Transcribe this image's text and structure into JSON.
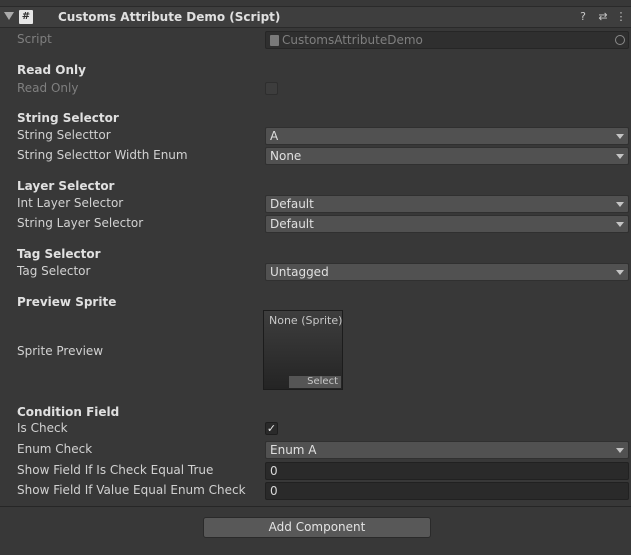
{
  "header": {
    "title": "Customs Attribute Demo (Script)",
    "script_icon_glyph": "#",
    "help_icon": "?",
    "preset_icon": "⇄",
    "menu_icon": "⋮"
  },
  "script_row": {
    "label": "Script",
    "value": "CustomsAttributeDemo"
  },
  "read_only": {
    "section": "Read Only",
    "label": "Read Only",
    "checked": false
  },
  "string_selector": {
    "section": "String Selector",
    "rows": [
      {
        "label": "String Selecttor",
        "value": "A"
      },
      {
        "label": "String Selecttor Width Enum",
        "value": "None"
      }
    ]
  },
  "layer_selector": {
    "section": "Layer Selector",
    "rows": [
      {
        "label": "Int Layer Selector",
        "value": "Default"
      },
      {
        "label": "String Layer Selector",
        "value": "Default"
      }
    ]
  },
  "tag_selector": {
    "section": "Tag Selector",
    "rows": [
      {
        "label": "Tag Selector",
        "value": "Untagged"
      }
    ]
  },
  "preview_sprite": {
    "section": "Preview Sprite",
    "label": "Sprite Preview",
    "value": "None (Sprite)",
    "select_label": "Select"
  },
  "condition_field": {
    "section": "Condition Field",
    "is_check": {
      "label": "Is Check",
      "checked": true,
      "check_glyph": "✓"
    },
    "enum_check": {
      "label": "Enum Check",
      "value": "Enum A"
    },
    "show_if_true": {
      "label": "Show Field If Is Check Equal True",
      "value": "0"
    },
    "show_if_enum": {
      "label": "Show Field If Value Equal Enum Check",
      "value": "0"
    }
  },
  "add_component": {
    "label": "Add Component"
  },
  "colors": {
    "background": "#383838",
    "header": "#3e3e3e",
    "dropdown": "#515151",
    "button": "#585858"
  }
}
